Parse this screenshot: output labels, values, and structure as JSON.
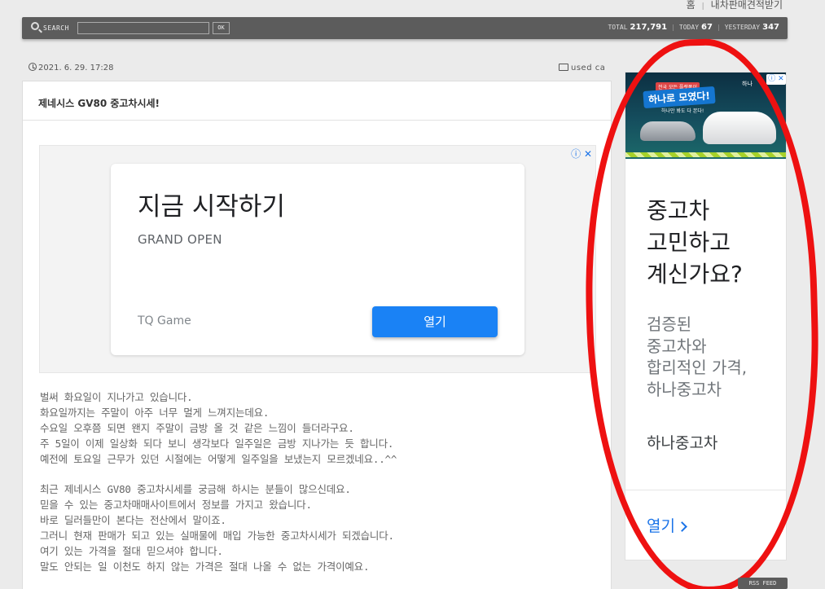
{
  "top_links": {
    "home": "홈",
    "sell_quote": "내차판매견적받기"
  },
  "search": {
    "label": "SEARCH",
    "value": "",
    "ok_label": "OK"
  },
  "stats": {
    "total_label": "TOTAL",
    "total_value": "217,791",
    "today_label": "TODAY",
    "today_value": "67",
    "yesterday_label": "YESTERDAY",
    "yesterday_value": "347",
    "separator": "|"
  },
  "post": {
    "date": "2021. 6. 29. 17:28",
    "category": "used ca",
    "title": "제네시스 GV80 중고차시세!",
    "paragraphs": [
      "벌써 화요일이 지나가고 있습니다.",
      "화요일까지는 주말이 아주 너무 멀게 느껴지는데요.",
      "수요일 오후쯤 되면 왠지 주말이 금방 올 것 같은 느낌이 들더라구요.",
      "주 5일이 이제 일상화 되다 보니 생각보다 일주일은 금방 지나가는 듯 합니다.",
      "예전에 토요일 근무가 있던 시절에는 어떻게 일주일을 보냈는지 모르겠네요..^^",
      "",
      "최근 제네시스 GV80 중고차시세를 궁금해 하시는 분들이 많으신데요.",
      "믿을 수 있는 중고차매매사이트에서 정보를 가지고 왔습니다.",
      "바로 딜러들만이 본다는 전산에서 말이죠.",
      "그러니 현재 판매가 되고 있는 실매물에 매입 가능한 중고차시세가 되겠습니다.",
      "여기 있는 가격을 절대 믿으셔야 합니다.",
      "말도 안되는 일 이천도 하지 않는 가격은 절대 나올 수 없는 가격이예요."
    ]
  },
  "ad_inline": {
    "adchoices": "ⓘ ✕",
    "headline": "지금 시작하기",
    "subline": "GRAND OPEN",
    "advertiser": "TQ Game",
    "button": "열기"
  },
  "ad_side": {
    "banner_top": "전국 모든 플랫폼이",
    "banner_main": "하나로 모였다!",
    "banner_sub": "하나만 봐도 다 본다!",
    "banner_logo": "하나",
    "banner_info": "ⓘ ✕",
    "headline_lines": [
      "중고차",
      "고민하고",
      "계신가요?"
    ],
    "desc_lines": [
      "검증된",
      "중고차와",
      "합리적인 가격,",
      "하나중고차"
    ],
    "advertiser": "하나중고차",
    "open_label": "열기"
  },
  "rss": {
    "label": "RSS FEED"
  },
  "colors": {
    "toolbar": "#5c5c5c",
    "ad_button": "#1a82f5",
    "ad_link": "#1a73e8",
    "annotation": "#ee1111"
  },
  "icons": {
    "search": "search-icon",
    "clock": "clock-icon",
    "folder": "folder-icon",
    "chevron": "chevron-right-icon"
  }
}
